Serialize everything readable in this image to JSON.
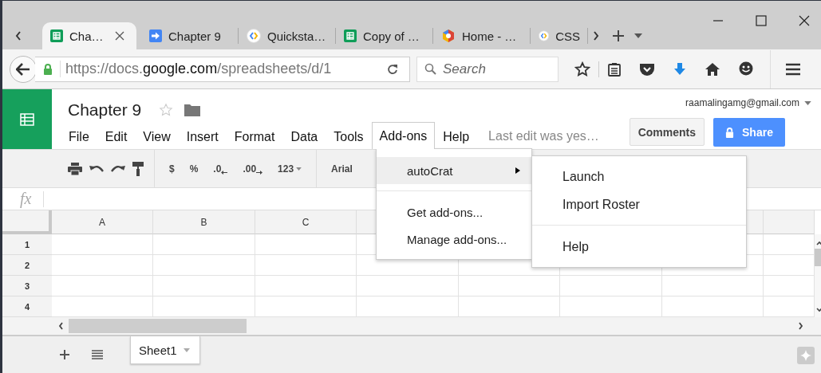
{
  "browser": {
    "tabs": [
      {
        "label": "Cha…",
        "selected": true
      },
      {
        "label": "Chapter 9",
        "selected": false
      },
      {
        "label": "Quicksta…",
        "selected": false
      },
      {
        "label": "Copy of …",
        "selected": false
      },
      {
        "label": "Home - …",
        "selected": false
      },
      {
        "label": "CSS",
        "selected": false
      }
    ],
    "address": {
      "scheme": "https://docs.",
      "domain": "google.com",
      "path": "/spreadsheets/d/1"
    },
    "search": {
      "placeholder": "Search"
    }
  },
  "document": {
    "title": "Chapter 9",
    "account": "raamalingamg@gmail.com",
    "menu": [
      {
        "label": "File",
        "selected": false
      },
      {
        "label": "Edit",
        "selected": false
      },
      {
        "label": "View",
        "selected": false
      },
      {
        "label": "Insert",
        "selected": false
      },
      {
        "label": "Format",
        "selected": false
      },
      {
        "label": "Data",
        "selected": false
      },
      {
        "label": "Tools",
        "selected": false
      },
      {
        "label": "Add-ons",
        "selected": true
      },
      {
        "label": "Help",
        "selected": false
      }
    ],
    "last_edit": "Last edit was yes…",
    "comments_button": "Comments",
    "share_button": "Share"
  },
  "toolbar": {
    "currency": "$",
    "percent": "%",
    "decrease_decimals": ".0",
    "increase_decimals": ".00",
    "number_format": "123",
    "font": "Arial"
  },
  "formula_bar": {
    "label": "fx"
  },
  "grid": {
    "columns": [
      "A",
      "B",
      "C"
    ],
    "rows": [
      "1",
      "2",
      "3",
      "4"
    ]
  },
  "addons_menu": {
    "groups": [
      [
        {
          "label": "autoCrat",
          "kind": "submenu",
          "selected": true
        }
      ],
      [
        {
          "label": "Get add-ons...",
          "kind": "item",
          "selected": false
        },
        {
          "label": "Manage add-ons...",
          "kind": "item",
          "selected": false
        }
      ]
    ]
  },
  "submenu": {
    "groups": [
      [
        {
          "label": "Launch"
        },
        {
          "label": "Import Roster"
        }
      ],
      [
        {
          "label": "Help"
        }
      ]
    ]
  },
  "sheet_tabs": [
    {
      "label": "Sheet1",
      "selected": true
    }
  ]
}
